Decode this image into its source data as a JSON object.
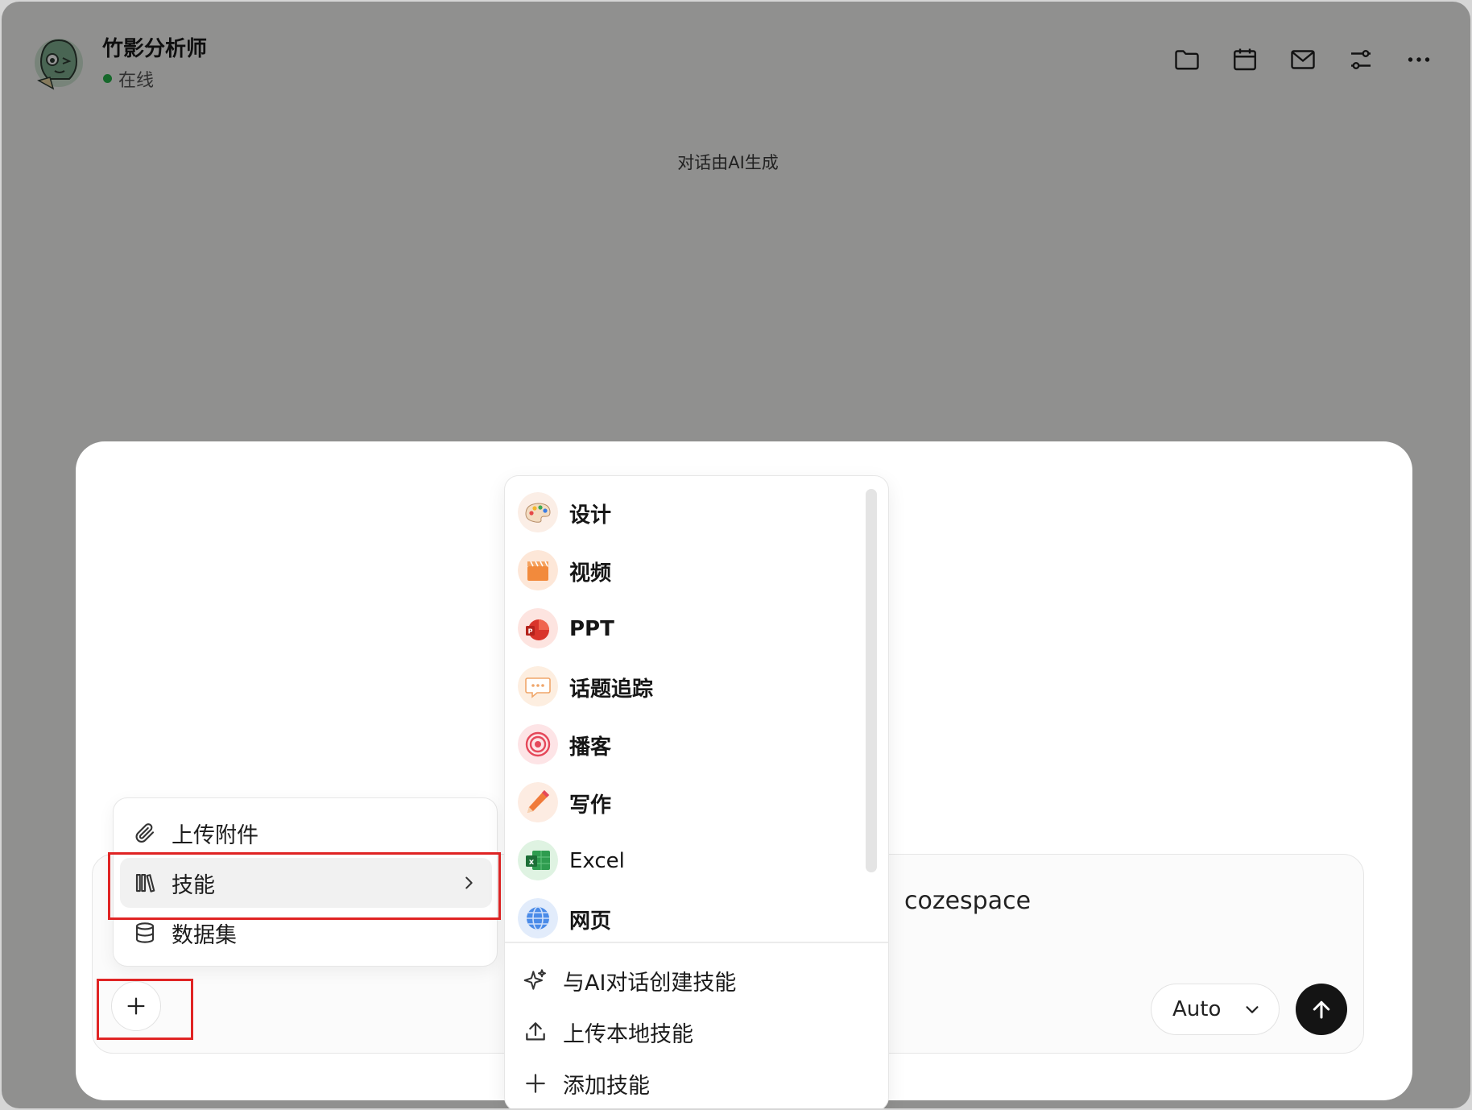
{
  "header": {
    "agent_name": "竹影分析师",
    "status": "在线"
  },
  "ai_note": "对话由AI生成",
  "composer": {
    "visible_text": "cozespace",
    "model": "Auto"
  },
  "attach_menu": {
    "items": [
      {
        "label": "上传附件",
        "icon": "paperclip-icon"
      },
      {
        "label": "技能",
        "icon": "books-icon"
      },
      {
        "label": "数据集",
        "icon": "database-icon"
      }
    ]
  },
  "skills_menu": {
    "skills": [
      {
        "label": "设计",
        "icon": "palette-icon"
      },
      {
        "label": "视频",
        "icon": "clapperboard-icon"
      },
      {
        "label": "PPT",
        "icon": "ppt-icon"
      },
      {
        "label": "话题追踪",
        "icon": "chat-bubble-icon"
      },
      {
        "label": "播客",
        "icon": "podcast-icon"
      },
      {
        "label": "写作",
        "icon": "pencil-icon"
      },
      {
        "label": "Excel",
        "icon": "excel-icon"
      },
      {
        "label": "网页",
        "icon": "globe-icon"
      }
    ],
    "actions": [
      {
        "label": "与AI对话创建技能",
        "icon": "sparkle-icon"
      },
      {
        "label": "上传本地技能",
        "icon": "upload-icon"
      },
      {
        "label": "添加技能",
        "icon": "plus-icon"
      }
    ]
  },
  "colors": {
    "status_online": "#27b34a",
    "highlight_box": "#e02424",
    "send_button": "#141414"
  }
}
